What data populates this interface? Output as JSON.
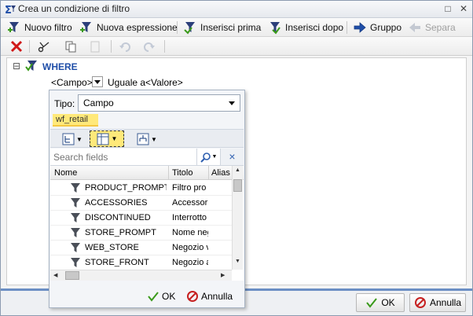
{
  "window": {
    "title": "Crea un condizione di filtro",
    "minimize_glyph": "□",
    "close_glyph": "✕"
  },
  "toolbar": {
    "new_filter": "Nuovo filtro",
    "new_expression": "Nuova espressione",
    "insert_before": "Inserisci prima",
    "insert_after": "Inserisci dopo",
    "group": "Gruppo",
    "separate": "Separa"
  },
  "tree": {
    "collapse_glyph": "⊟",
    "root_label": "WHERE",
    "condition": {
      "field": "<Campo>",
      "operator": "Uguale a",
      "value": "<Valore>"
    }
  },
  "popup": {
    "type_label": "Tipo:",
    "type_value": "Campo",
    "datasource": "wf_retail",
    "search_placeholder": "Search fields",
    "clear_glyph": "×",
    "columns": [
      "Nome",
      "Titolo",
      "Alias"
    ],
    "rows": [
      {
        "name": "PRODUCT_PROMPT",
        "title": "Filtro pro"
      },
      {
        "name": "ACCESSORIES",
        "title": "Accessori"
      },
      {
        "name": "DISCONTINUED",
        "title": "Interrotto"
      },
      {
        "name": "STORE_PROMPT",
        "title": "Nome neg"
      },
      {
        "name": "WEB_STORE",
        "title": "Negozio v"
      },
      {
        "name": "STORE_FRONT",
        "title": "Negozio a"
      }
    ],
    "ok": "OK",
    "cancel": "Annulla"
  },
  "footer": {
    "ok": "OK",
    "cancel": "Annulla"
  },
  "colors": {
    "accent_blue": "#1f4ea8",
    "highlight_yellow": "#ffe97a",
    "ok_green": "#3a9a1a",
    "cancel_red": "#c62020"
  }
}
